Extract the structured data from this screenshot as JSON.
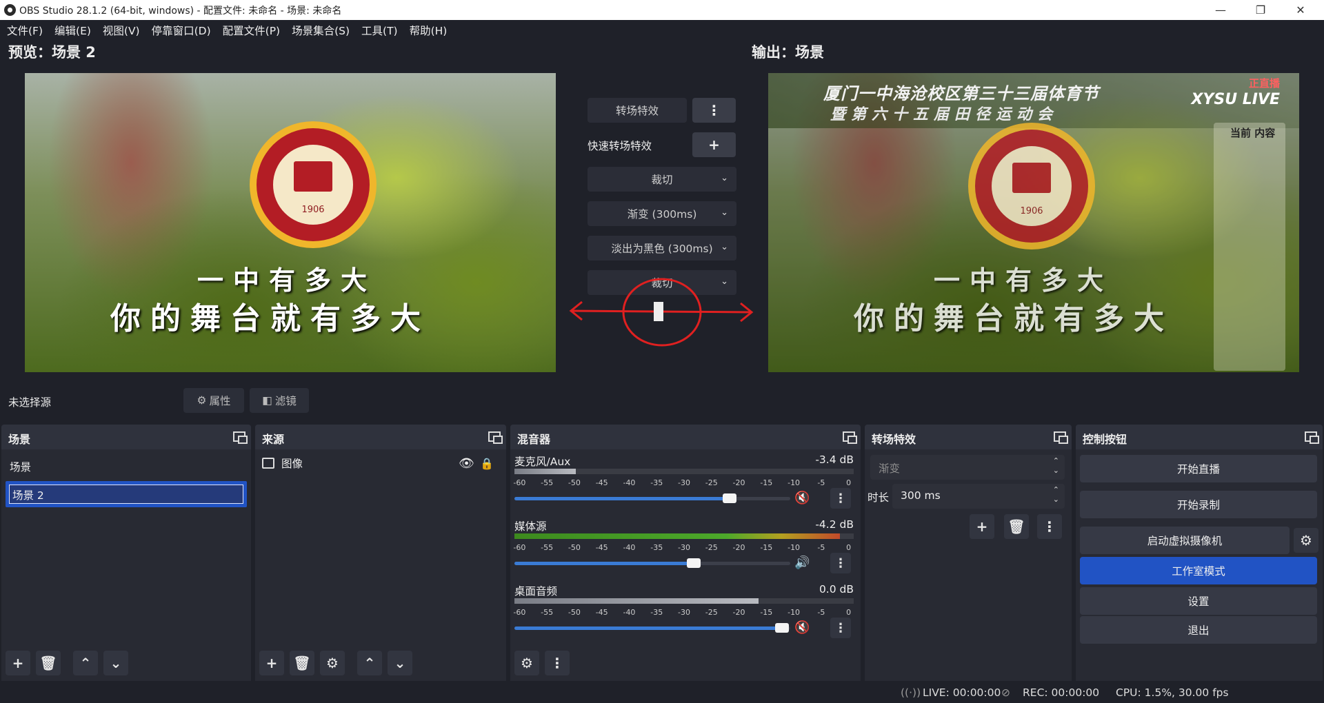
{
  "window": {
    "title": "OBS Studio 28.1.2 (64-bit, windows) - 配置文件: 未命名 - 场景: 未命名",
    "min": "—",
    "max": "❐",
    "close": "✕"
  },
  "menu": [
    "文件(F)",
    "编辑(E)",
    "视图(V)",
    "停靠窗口(D)",
    "配置文件(P)",
    "场景集合(S)",
    "工具(T)",
    "帮助(H)"
  ],
  "preview": {
    "title": "预览：场景 2",
    "logo_year": "1906",
    "slogan_line1": "一中有多大",
    "slogan_line2": "你的舞台就有多大"
  },
  "program": {
    "title": "输出：场景",
    "banner_line1": "厦门一中海沧校区第三十三届体育节",
    "banner_line2": "暨第六十五届田径运动会",
    "brand": "XYSU LIVE",
    "live_tag": "正直播",
    "side_title": "当前\n内容",
    "logo_year": "1906",
    "slogan_line1": "一中有多大",
    "slogan_line2": "你的舞台就有多大"
  },
  "transitions_mid": {
    "transition_btn": "转场特效",
    "quick_label": "快速转场特效",
    "items": [
      "裁切",
      "渐变 (300ms)",
      "淡出为黑色 (300ms)",
      "裁切"
    ]
  },
  "source_toolbar": {
    "no_source": "未选择源",
    "properties": "属性",
    "filters": "滤镜"
  },
  "docks": {
    "scenes": {
      "title": "场景",
      "items": [
        "场景",
        "场景 2"
      ]
    },
    "sources": {
      "title": "来源",
      "items": [
        {
          "name": "图像"
        }
      ]
    },
    "mixer": {
      "title": "混音器",
      "scale": [
        "-60",
        "-55",
        "-50",
        "-45",
        "-40",
        "-35",
        "-30",
        "-25",
        "-20",
        "-15",
        "-10",
        "-5",
        "0"
      ],
      "channels": [
        {
          "name": "麦克风/Aux",
          "db": "-3.4 dB",
          "level": 0.18,
          "volume": 0.78,
          "muted": true
        },
        {
          "name": "媒体源",
          "db": "-4.2 dB",
          "level": 0.96,
          "volume": 0.65,
          "muted": false
        },
        {
          "name": "桌面音频",
          "db": "0.0 dB",
          "level": 0.72,
          "volume": 0.97,
          "muted": true
        }
      ]
    },
    "transitions": {
      "title": "转场特效",
      "combo": "渐变",
      "duration_label": "时长",
      "duration": "300 ms"
    },
    "controls": {
      "title": "控制按钮",
      "buttons": [
        "开始直播",
        "开始录制",
        "启动虚拟摄像机",
        "工作室模式",
        "设置",
        "退出"
      ]
    }
  },
  "status": {
    "live": "LIVE: 00:00:00",
    "rec": "REC: 00:00:00",
    "cpu": "CPU: 1.5%, 30.00 fps"
  }
}
